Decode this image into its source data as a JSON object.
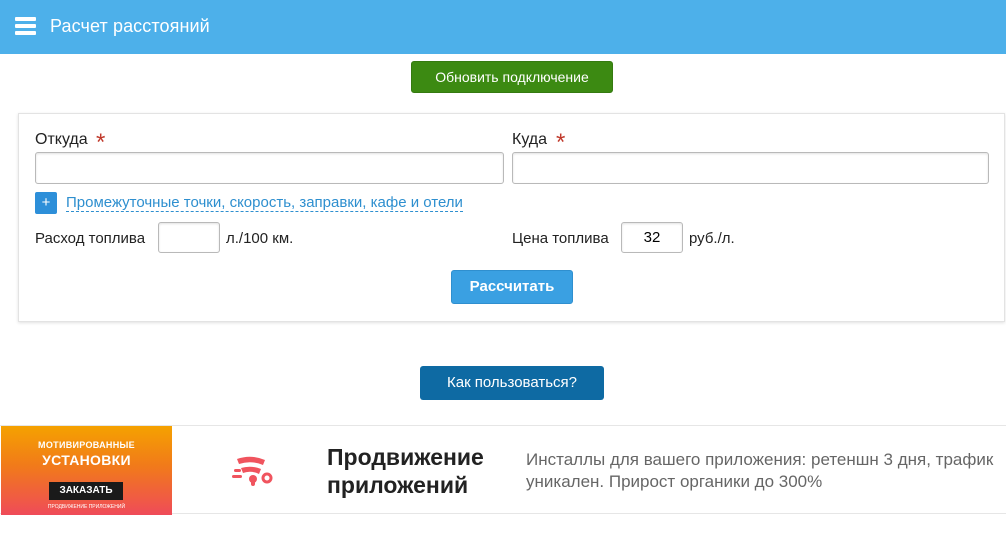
{
  "header": {
    "title": "Расчет расстояний",
    "menu_icon": "hamburger-menu-icon",
    "bg_color": "#4db0ea"
  },
  "refresh_button": {
    "label": "Обновить подключение",
    "color": "#3c8a12"
  },
  "form": {
    "from": {
      "label": "Откуда",
      "required_mark": "*",
      "value": ""
    },
    "to": {
      "label": "Куда",
      "required_mark": "*",
      "value": ""
    },
    "extra": {
      "icon_glyph": "+",
      "link_text": "Промежуточные точки, скорость, заправки, кафе и отели"
    },
    "fuel_consumption": {
      "label": "Расход топлива",
      "value": "",
      "unit": "л./100 км."
    },
    "fuel_price": {
      "label": "Цена топлива",
      "value": "32",
      "unit": "руб./л."
    },
    "calculate_label": "Рассчитать"
  },
  "help_button": {
    "label": "Как пользоваться?",
    "color": "#0e6aa3"
  },
  "ad": {
    "banner": {
      "line1": "МОТИВИРОВАННЫЕ",
      "line2": "УСТАНОВКИ",
      "cta": "ЗАКАЗАТЬ",
      "caption": "ПРОДВИЖЕНИЕ ПРИЛОЖЕНИЙ"
    },
    "logo_icon": "app-promo-logo-icon",
    "title": "Продвижение приложений",
    "text": "Инсталлы для вашего приложения: ретеншн 3 дня, трафик уникален. Прирост органики до 300%"
  }
}
